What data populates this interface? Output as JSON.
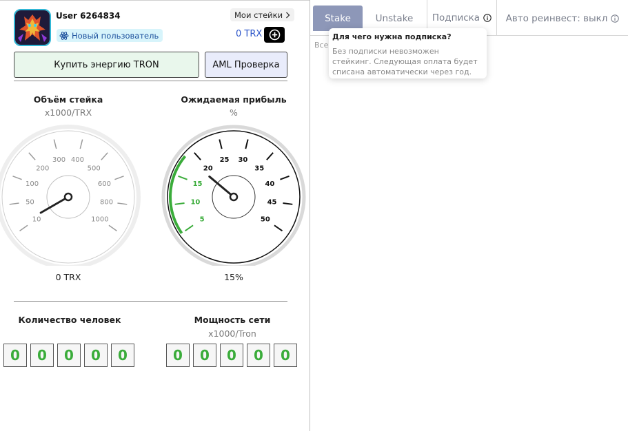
{
  "user": {
    "name": "User 6264834",
    "status": "Новый пользователь",
    "my_stakes": "Мои стейки",
    "balance": "0 TRX"
  },
  "actions": {
    "buy_energy": "Купить энергию TRON",
    "aml_check": "AML Проверка"
  },
  "stake_gauge": {
    "title": "Объём стейка",
    "unit": "x1000/TRX",
    "ticks": [
      "10",
      "50",
      "100",
      "200",
      "300",
      "400",
      "500",
      "600",
      "800",
      "1000"
    ],
    "value_text": "0 TRX",
    "level": 0
  },
  "profit_gauge": {
    "title": "Ожидаемая прибыль",
    "unit": "%",
    "ticks": [
      "5",
      "10",
      "15",
      "20",
      "25",
      "30",
      "35",
      "40",
      "45",
      "50"
    ],
    "value_text": "15%",
    "level": 15,
    "accent": "#3aac3a"
  },
  "people_counter": {
    "title": "Количество человек",
    "digits": [
      "0",
      "0",
      "0",
      "0",
      "0"
    ]
  },
  "network_counter": {
    "title": "Мощность сети",
    "unit": "x1000/Tron",
    "digits": [
      "0",
      "0",
      "0",
      "0",
      "0"
    ]
  },
  "tabs": {
    "stake": "Stake",
    "unstake": "Unstake",
    "subscription": "Подписка",
    "reinvest": "Авто реинвест: выкл"
  },
  "content_partial": "Все",
  "tooltip": {
    "title": "Для чего нужна подписка?",
    "body": "Без подписки невозможен стейкинг. Следующая оплата будет списана автоматически через год."
  },
  "colors": {
    "active_tab": "#8d97b8",
    "digit_green": "#3aac3a",
    "badge_bg": "#d7f4fb",
    "balance_blue": "#2b54c9"
  }
}
